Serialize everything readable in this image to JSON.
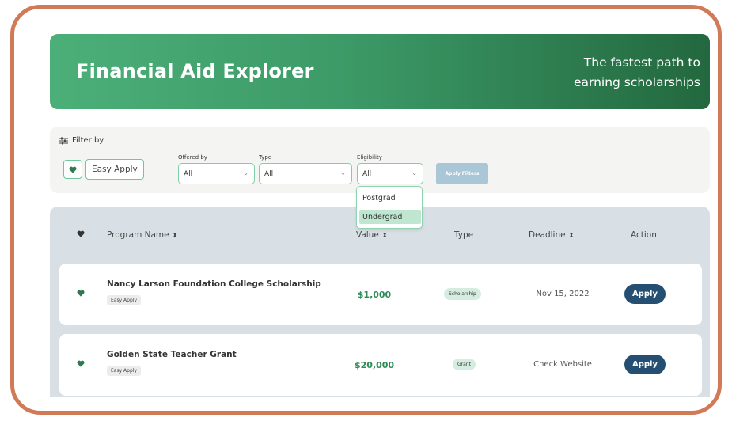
{
  "banner": {
    "title": "Financial Aid Explorer",
    "tagline_line1": "The fastest path to",
    "tagline_line2": "earning scholarships"
  },
  "filters": {
    "filter_by_label": "Filter by",
    "easy_apply_label": "Easy Apply",
    "offered_by": {
      "label": "Offered by",
      "value": "All"
    },
    "type": {
      "label": "Type",
      "value": "All"
    },
    "eligibility": {
      "label": "Eligibility",
      "value": "All",
      "options": [
        "Postgrad",
        "Undergrad"
      ],
      "highlighted": "Undergrad"
    },
    "apply_button": "Apply Filters"
  },
  "table": {
    "headers": {
      "program_name": "Program Name",
      "value": "Value",
      "type": "Type",
      "deadline": "Deadline",
      "action": "Action"
    },
    "rows": [
      {
        "name": "Nancy Larson Foundation College Scholarship",
        "badge": "Easy Apply",
        "value": "$1,000",
        "type": "Scholarship",
        "deadline": "Nov 15, 2022",
        "action": "Apply"
      },
      {
        "name": "Golden State Teacher Grant",
        "badge": "Easy Apply",
        "value": "$20,000",
        "type": "Grant",
        "deadline": "Check Website",
        "action": "Apply"
      }
    ]
  },
  "colors": {
    "frame": "#d17a57",
    "banner_start": "#4caf78",
    "banner_end": "#23683f",
    "accent_green": "#2e8b57",
    "apply_button": "#254f72"
  },
  "icons": {
    "heart": "heart-icon",
    "filter": "sliders-icon",
    "sort": "sort-icon",
    "chevron": "chevron-down-icon"
  }
}
